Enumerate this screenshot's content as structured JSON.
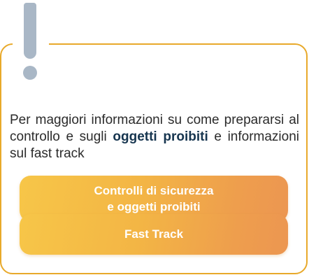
{
  "notice": {
    "text_before": "Per maggiori informazioni su come prepararsi al controllo e sugli ",
    "bold_1": "oggetti",
    "text_gap": " ",
    "bold_2": "proibiti",
    "text_after": " e informazioni sul fast track"
  },
  "buttons": {
    "security_line1": "Controlli di sicurezza",
    "security_line2": "e oggetti proibiti",
    "fast_track": "Fast Track"
  },
  "colors": {
    "border": "#e8a92a",
    "icon": "#a9b7c6",
    "button_gradient_start": "#f7c648",
    "button_gradient_end": "#ec9651",
    "bold_text": "#16354f"
  },
  "icons": {
    "notice_icon": "exclamation-mark-icon"
  }
}
